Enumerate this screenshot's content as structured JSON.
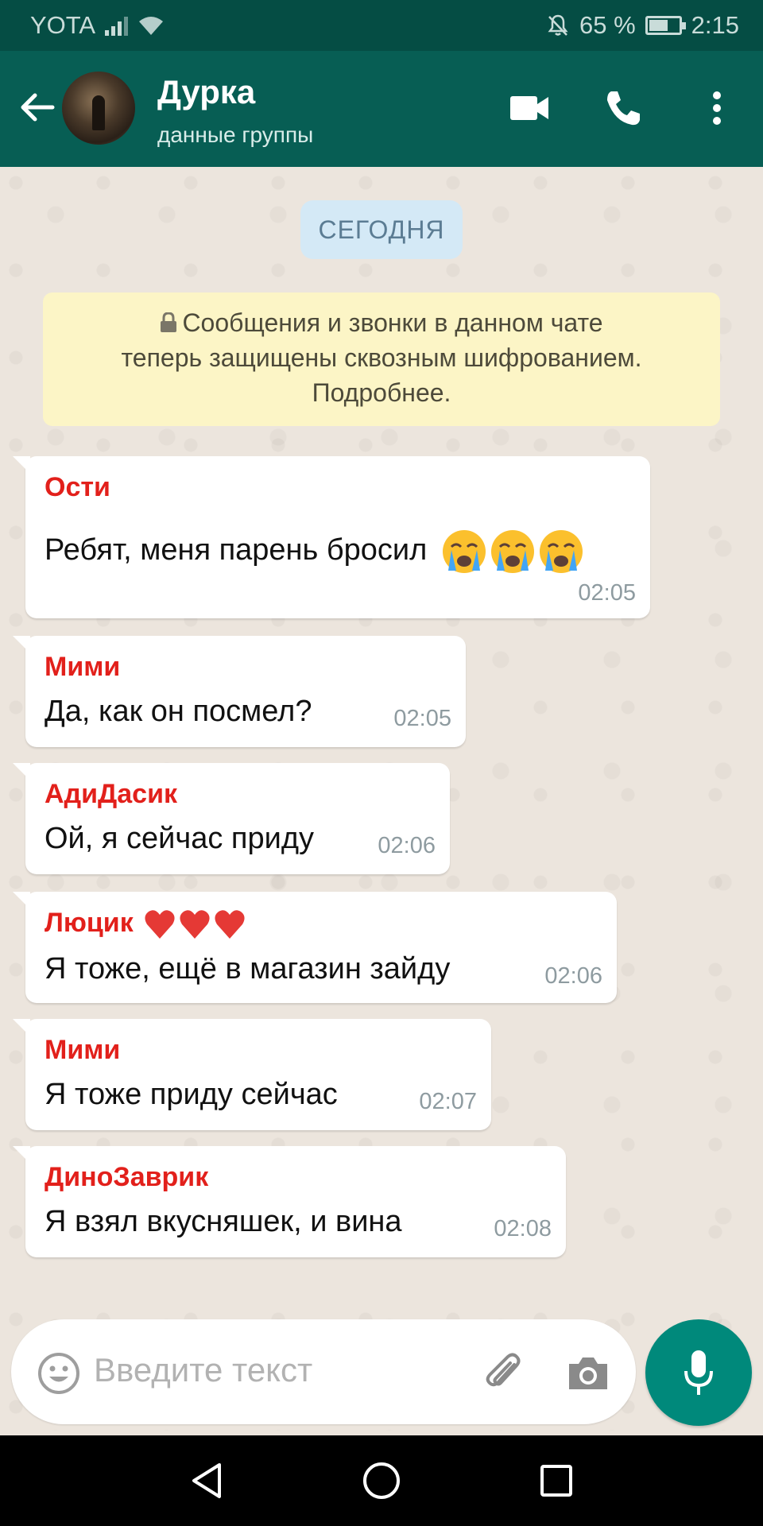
{
  "status_bar": {
    "carrier": "YOTA",
    "battery_percent": "65 %",
    "battery_level": 0.65,
    "time": "2:15",
    "icons": [
      "signal-icon",
      "wifi-icon",
      "mute-bell-icon",
      "battery-icon"
    ]
  },
  "header": {
    "title": "Дурка",
    "subtitle": "данные группы",
    "icons": [
      "back-arrow-icon",
      "group-avatar",
      "video-call-icon",
      "phone-icon",
      "more-vert-icon"
    ]
  },
  "chat": {
    "date_chip": "СЕГОДНЯ",
    "e2e_notice": {
      "line1": "Сообщения и звонки в данном чате",
      "line2": "теперь защищены сквозным шифрованием.",
      "line3": "Подробнее."
    },
    "messages": [
      {
        "sender": "Ости",
        "text": "Ребят, меня парень бросил",
        "emoji": "crying-face x3",
        "time": "02:05"
      },
      {
        "sender": "Мими",
        "text": "Да, как он посмел?",
        "time": "02:05"
      },
      {
        "sender": "АдиДасик",
        "text": "Ой, я сейчас приду",
        "time": "02:06"
      },
      {
        "sender": "Люцик",
        "sender_emoji": "red-heart x3",
        "text": "Я тоже, ещё в магазин зайду",
        "time": "02:06"
      },
      {
        "sender": "Мими",
        "text": "Я тоже приду сейчас",
        "time": "02:07"
      },
      {
        "sender": "ДиноЗаврик",
        "text": "Я взял вкусняшек, и вина",
        "time": "02:08"
      }
    ]
  },
  "input": {
    "placeholder": "Введите текст",
    "icons": [
      "emoji-icon",
      "attach-icon",
      "camera-icon",
      "mic-icon"
    ]
  },
  "nav": {
    "icons": [
      "nav-back-icon",
      "nav-home-icon",
      "nav-recents-icon"
    ]
  },
  "colors": {
    "status_bar": "#054d44",
    "app_bar": "#075e54",
    "sender_name": "#e2201b",
    "mic_button": "#00897b",
    "chat_bg": "#ece5dd",
    "notice_bg": "#fcf5c6",
    "date_chip_bg": "#d4e9f6"
  }
}
